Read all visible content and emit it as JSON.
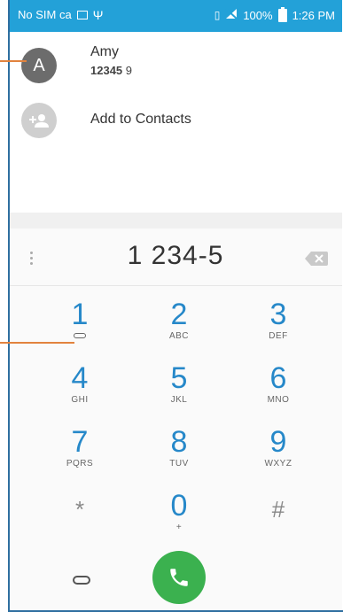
{
  "status_bar": {
    "carrier": "No SIM ca",
    "battery": "100%",
    "time": "1:26 PM",
    "color": "#23a1d8"
  },
  "suggestions": [
    {
      "initial": "A",
      "name": "Amy",
      "number_bold": "12345",
      "number_rest": " 9"
    },
    {
      "label": "Add to Contacts"
    }
  ],
  "dialpad": {
    "dialed_number": "1 234-5",
    "keys": [
      {
        "digit": "1",
        "letters": ""
      },
      {
        "digit": "2",
        "letters": "ABC"
      },
      {
        "digit": "3",
        "letters": "DEF"
      },
      {
        "digit": "4",
        "letters": "GHI"
      },
      {
        "digit": "5",
        "letters": "JKL"
      },
      {
        "digit": "6",
        "letters": "MNO"
      },
      {
        "digit": "7",
        "letters": "PQRS"
      },
      {
        "digit": "8",
        "letters": "TUV"
      },
      {
        "digit": "9",
        "letters": "WXYZ"
      },
      {
        "digit": "*",
        "letters": ""
      },
      {
        "digit": "0",
        "letters": "+"
      },
      {
        "digit": "#",
        "letters": ""
      }
    ],
    "accent_color": "#2688c9",
    "call_button_color": "#3bb14f"
  }
}
